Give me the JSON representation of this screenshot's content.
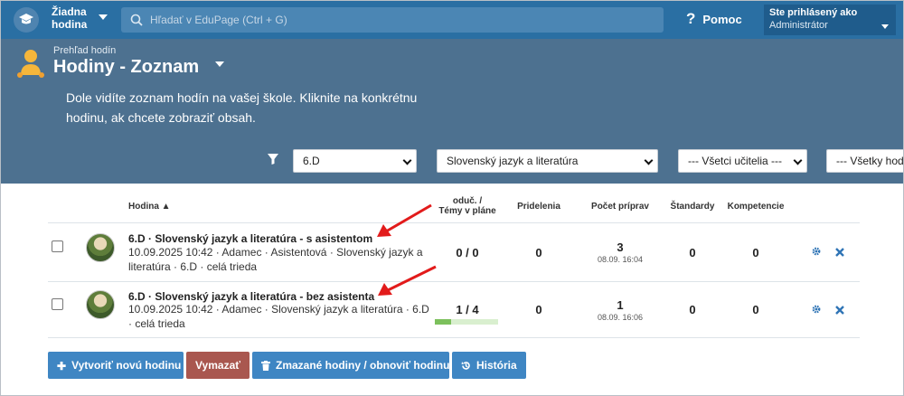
{
  "topbar": {
    "user_menu": "Žiadna hodina",
    "search_placeholder": "Hľadať v EduPage (Ctrl + G)",
    "help_label": "Pomoc",
    "logged_in_label": "Ste prihlásený ako",
    "logged_in_role": "Administrátor"
  },
  "header": {
    "breadcrumb": "Prehľad hodín",
    "title": "Hodiny - Zoznam",
    "description": "Dole vidíte zoznam hodín na vašej škole. Kliknite na konkrétnu hodinu, ak chcete zobraziť obsah."
  },
  "filters": {
    "class": "6.D",
    "subject": "Slovenský jazyk a literatúra",
    "teacher": "--- Všetci učitelia ---",
    "group": "--- Všetky hod"
  },
  "table": {
    "headers": {
      "lesson": "Hodina ▲",
      "taught_line1": "oduč. /",
      "taught_line2": "Témy v pláne",
      "assignments": "Pridelenia",
      "preparations": "Počet príprav",
      "standards": "Štandardy",
      "competences": "Kompetencie"
    },
    "rows": [
      {
        "title": "6.D · Slovenský jazyk a literatúra - s asistentom",
        "meta": "10.09.2025 10:42 · Adamec · Asistentová · Slovenský jazyk a literatúra · 6.D · celá trieda",
        "taught": "0 / 0",
        "assignments": "0",
        "preparations": "3",
        "preparations_date": "08.09. 16:04",
        "standards": "0",
        "competences": "0",
        "progress": 0
      },
      {
        "title": "6.D · Slovenský jazyk a literatúra - bez asistenta",
        "meta": "10.09.2025 10:42 · Adamec · Slovenský jazyk a literatúra · 6.D · celá trieda",
        "taught": "1 / 4",
        "assignments": "0",
        "preparations": "1",
        "preparations_date": "08.09. 16:06",
        "standards": "0",
        "competences": "0",
        "progress": 0.25
      }
    ]
  },
  "buttons": {
    "create": "Vytvoriť novú hodinu",
    "delete": "Vymazať",
    "deleted": "Zmazané hodiny / obnoviť hodinu",
    "history": "História"
  },
  "colors": {
    "topbar": "#2a6fa3",
    "panel": "#4d7190",
    "button_blue": "#3f86c3",
    "button_red": "#a9574f",
    "annotation_arrow": "#e21b1b"
  }
}
